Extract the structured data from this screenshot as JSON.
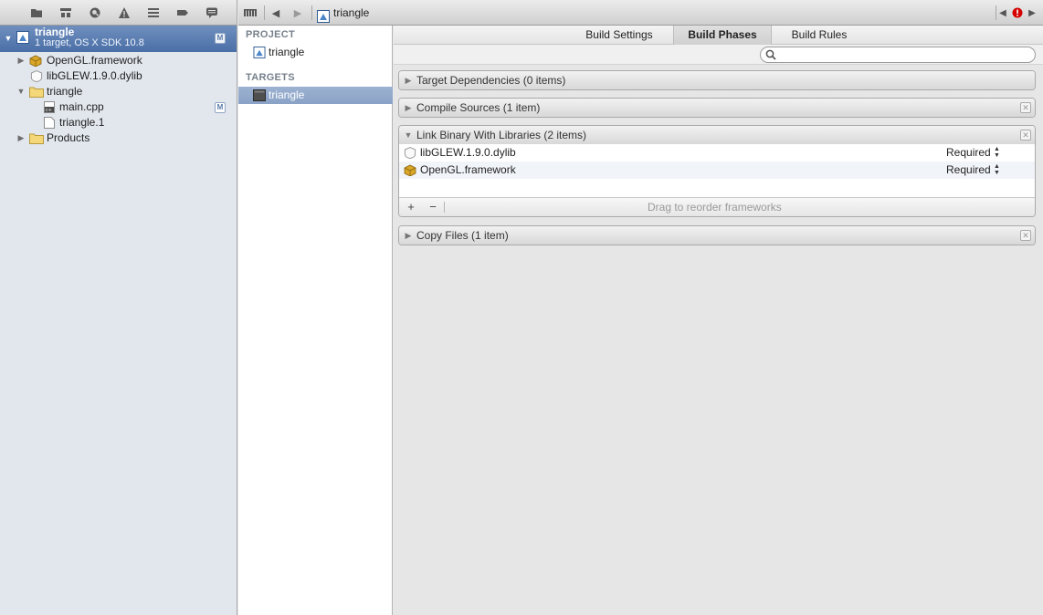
{
  "navigator": {
    "toolbar_icons": [
      "folder-icon",
      "hierarchy-icon",
      "search-icon",
      "warning-icon",
      "list-icon",
      "tag-icon",
      "comment-icon"
    ],
    "project": {
      "name": "triangle",
      "subtitle": "1 target, OS X SDK 10.8",
      "badge": "M"
    },
    "items": [
      {
        "label": "OpenGL.framework",
        "icon": "framework-icon"
      },
      {
        "label": "libGLEW.1.9.0.dylib",
        "icon": "dylib-icon"
      },
      {
        "label": "triangle",
        "icon": "folder-icon"
      },
      {
        "label": "main.cpp",
        "icon": "cpp-file-icon",
        "badge": "M"
      },
      {
        "label": "triangle.1",
        "icon": "document-icon"
      },
      {
        "label": "Products",
        "icon": "folder-icon"
      }
    ]
  },
  "jumpbar": {
    "crumb": "triangle"
  },
  "targets_pane": {
    "project_header": "PROJECT",
    "project_item": "triangle",
    "targets_header": "TARGETS",
    "target_item": "triangle"
  },
  "editor": {
    "tabs": [
      {
        "label": "Build Settings"
      },
      {
        "label": "Build Phases"
      },
      {
        "label": "Build Rules"
      }
    ],
    "search_placeholder": "",
    "phases": {
      "target_dependencies": "Target Dependencies (0 items)",
      "compile_sources": "Compile Sources (1 item)",
      "link_binary": "Link Binary With Libraries (2 items)",
      "copy_files": "Copy Files (1 item)"
    },
    "libraries": [
      {
        "name": "libGLEW.1.9.0.dylib",
        "status": "Required"
      },
      {
        "name": "OpenGL.framework",
        "status": "Required"
      }
    ],
    "footer": {
      "add": "+",
      "remove": "−",
      "hint": "Drag to reorder frameworks"
    }
  },
  "colors": {
    "selection": "#4a6fa7",
    "error": "#d40000"
  }
}
